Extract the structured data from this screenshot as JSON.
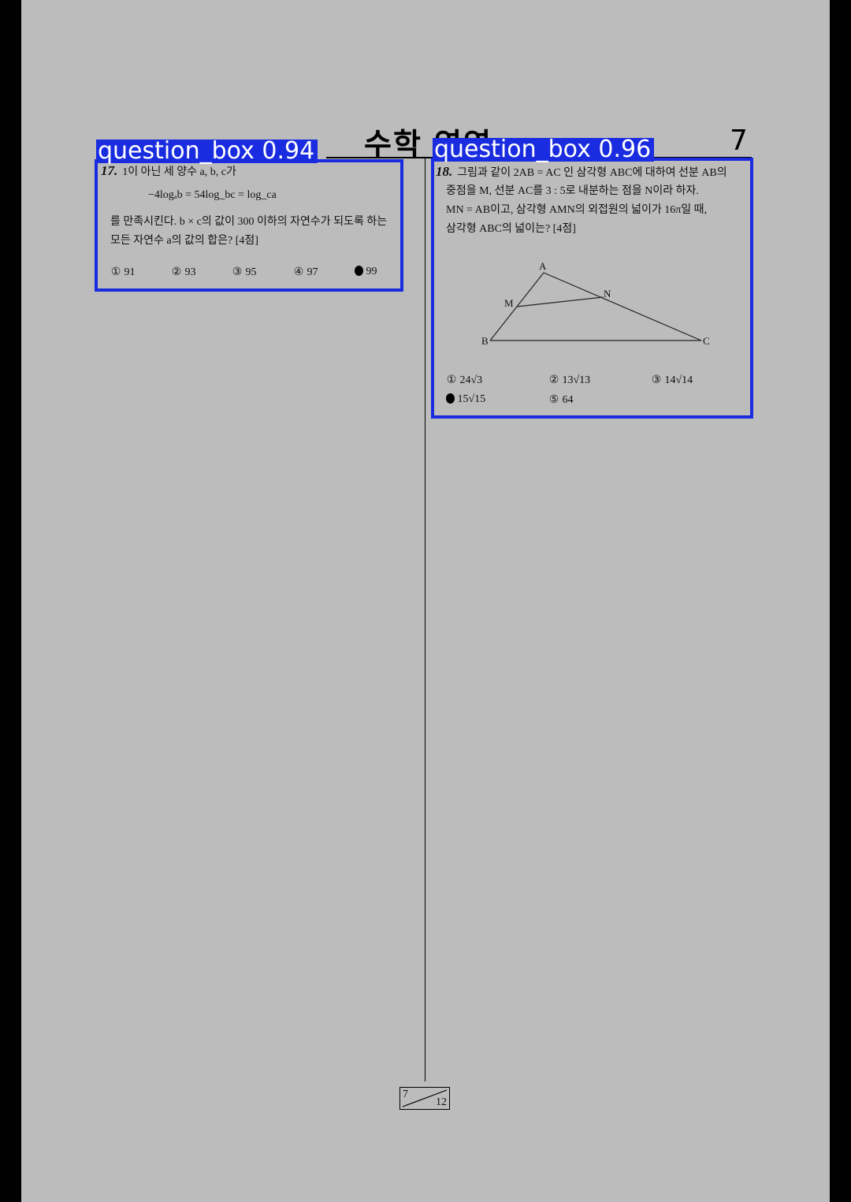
{
  "header": {
    "title": "수학 영역",
    "page_number": "7"
  },
  "detections": [
    {
      "label": "question_box 0.94"
    },
    {
      "label": "question_box 0.96"
    }
  ],
  "q17": {
    "number": "17.",
    "intro": "1이 아닌 세 양수 a, b, c가",
    "formula": "−4logₐb = 54log_bc = log_ca",
    "body1": "를 만족시킨다. b × c의 값이 300 이하의 자연수가 되도록 하는",
    "body2": "모든 자연수 a의 값의 합은? [4점]",
    "choices": [
      {
        "mark": "①",
        "text": "91",
        "selected": false
      },
      {
        "mark": "②",
        "text": "93",
        "selected": false
      },
      {
        "mark": "③",
        "text": "95",
        "selected": false
      },
      {
        "mark": "④",
        "text": "97",
        "selected": false
      },
      {
        "mark": "⑤",
        "text": "99",
        "selected": true
      }
    ]
  },
  "q18": {
    "number": "18.",
    "line1": "그림과 같이 2AB = AC 인 삼각형 ABC에 대하여 선분 AB의",
    "line2": "중점을 M, 선분 AC를 3 : 5로 내분하는 점을 N이라 하자.",
    "line3": "MN = AB이고, 삼각형 AMN의 외접원의 넓이가 16π일 때,",
    "line4": "삼각형 ABC의 넓이는? [4점]",
    "figure_labels": {
      "A": "A",
      "M": "M",
      "N": "N",
      "B": "B",
      "C": "C"
    },
    "choices": [
      {
        "mark": "①",
        "text": "24√3",
        "selected": false
      },
      {
        "mark": "②",
        "text": "13√13",
        "selected": false
      },
      {
        "mark": "③",
        "text": "14√14",
        "selected": false
      },
      {
        "mark": "④",
        "text": "15√15",
        "selected": true
      },
      {
        "mark": "⑤",
        "text": "64",
        "selected": false
      }
    ]
  },
  "footer": {
    "current": "7",
    "total": "12"
  }
}
